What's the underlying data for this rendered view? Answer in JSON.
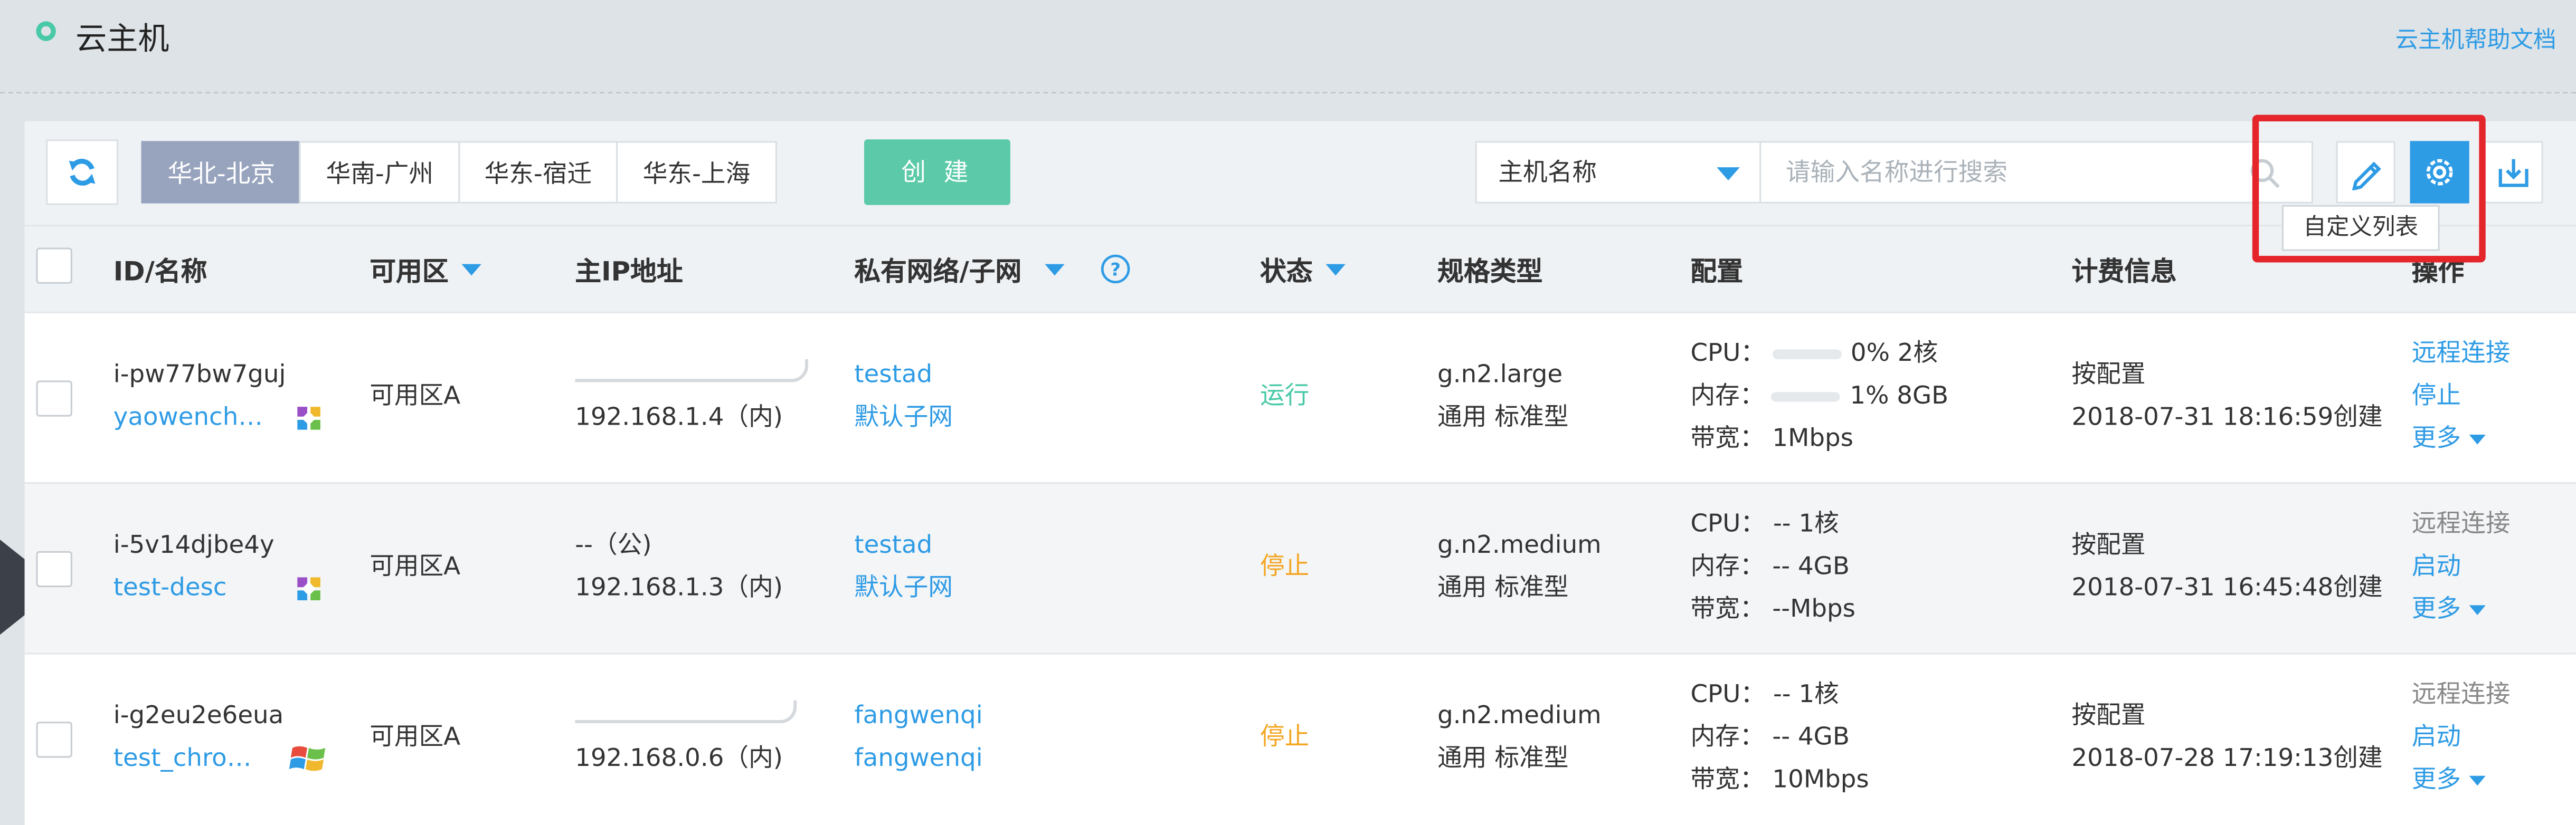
{
  "page": {
    "title": "云主机",
    "help_link": "云主机帮助文档"
  },
  "toolbar": {
    "regions": [
      "华北-北京",
      "华南-广州",
      "华东-宿迁",
      "华东-上海"
    ],
    "active_region": "华北-北京",
    "create_label": "创 建",
    "search_field": "主机名称",
    "search_placeholder": "请输入名称进行搜索",
    "tooltip": "自定义列表"
  },
  "columns": {
    "id_name": "ID/名称",
    "zone": "可用区",
    "ip": "主IP地址",
    "vpc": "私有网络/子网",
    "status": "状态",
    "spec": "规格类型",
    "config": "配置",
    "billing": "计费信息",
    "actions": "操作"
  },
  "labels": {
    "cpu": "CPU：",
    "mem": "内存：",
    "bw": "带宽："
  },
  "rows": [
    {
      "id": "i-pw77bw7guj",
      "name": "yaowench…",
      "os_icon": "centos-icon",
      "zone": "可用区A",
      "ip_public": "",
      "ip_private": "192.168.1.4（内)",
      "vpc": "testad",
      "subnet": "默认子网",
      "status": "运行",
      "status_color": "#48c9a7",
      "spec": "g.n2.large",
      "spec_type": "通用 标准型",
      "cpu": "0%  2核",
      "mem": "1%  8GB",
      "bw": "1Mbps",
      "show_bars": true,
      "billing": "按配置",
      "created": "2018-07-31 18:16:59创建",
      "act1": "远程连接",
      "act1_enabled": true,
      "act2": "停止",
      "act3": "更多"
    },
    {
      "id": "i-5v14djbe4y",
      "name": "test-desc",
      "os_icon": "centos-icon",
      "zone": "可用区A",
      "ip_public": "--（公)",
      "ip_private": "192.168.1.3（内)",
      "vpc": "testad",
      "subnet": "默认子网",
      "status": "停止",
      "status_color": "#f4a622",
      "spec": "g.n2.medium",
      "spec_type": "通用 标准型",
      "cpu": "--  1核",
      "mem": "--  4GB",
      "bw": "--Mbps",
      "show_bars": false,
      "billing": "按配置",
      "created": "2018-07-31 16:45:48创建",
      "act1": "远程连接",
      "act1_enabled": false,
      "act2": "启动",
      "act3": "更多"
    },
    {
      "id": "i-g2eu2e6eua",
      "name": "test_chro…",
      "os_icon": "windows-icon",
      "zone": "可用区A",
      "ip_public": "",
      "ip_private": "192.168.0.6（内)",
      "vpc": "fangwenqi",
      "subnet": "fangwenqi",
      "status": "停止",
      "status_color": "#f4a622",
      "spec": "g.n2.medium",
      "spec_type": "通用 标准型",
      "cpu": "--  1核",
      "mem": "--  4GB",
      "bw": "10Mbps",
      "show_bars": false,
      "billing": "按配置",
      "created": "2018-07-28 17:19:13创建",
      "act1": "远程连接",
      "act1_enabled": false,
      "act2": "启动",
      "act3": "更多"
    }
  ],
  "colors": {
    "accent": "#2e9be5",
    "create": "#5ccaa8",
    "region_active": "#98a4be",
    "highlight": "#e4262b"
  }
}
